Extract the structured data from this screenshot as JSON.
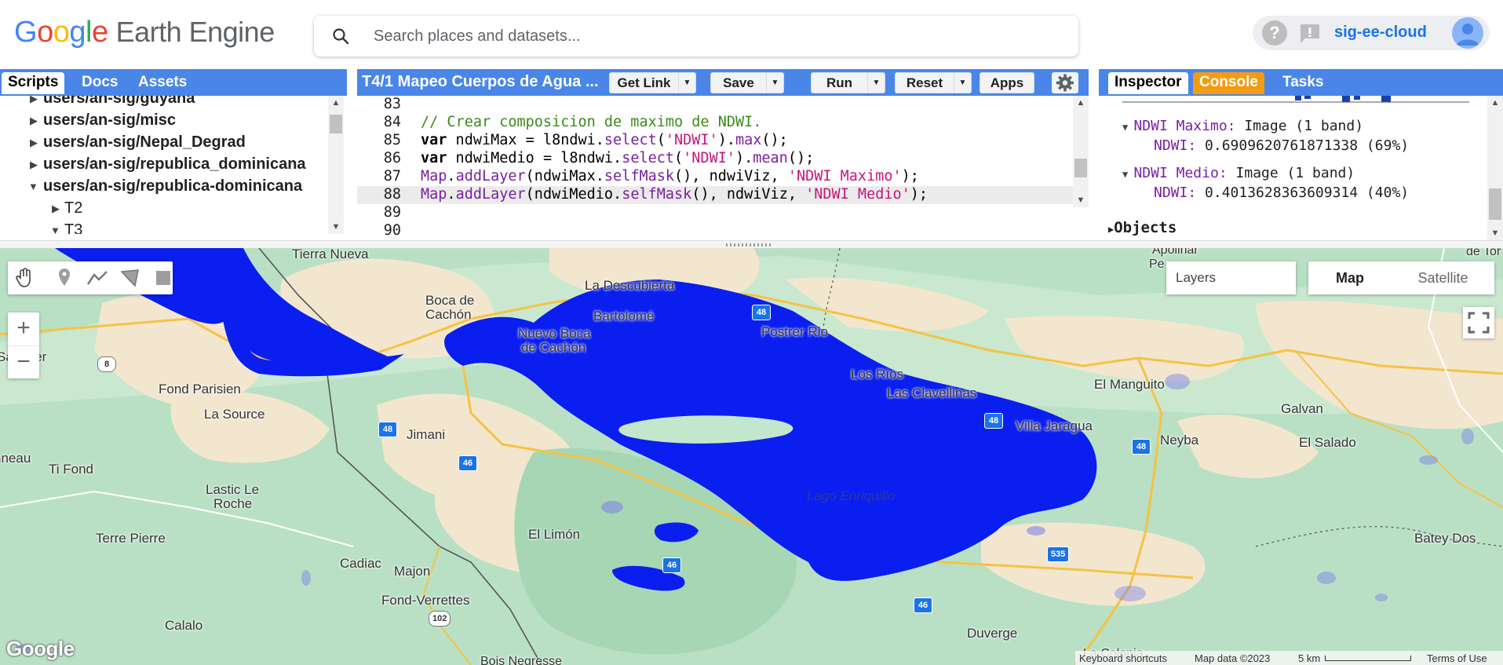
{
  "header": {
    "logo_google": [
      "G",
      "o",
      "o",
      "g",
      "l",
      "e"
    ],
    "logo_product": "Earth Engine",
    "search_placeholder": "Search places and datasets...",
    "project_name": "sig-ee-cloud"
  },
  "scripts_panel": {
    "tabs": [
      "Scripts",
      "Docs",
      "Assets"
    ],
    "tree": [
      {
        "label": "users/an-sig/guyana",
        "type": "user",
        "expanded": false
      },
      {
        "label": "users/an-sig/misc",
        "type": "user",
        "expanded": false
      },
      {
        "label": "users/an-sig/Nepal_Degrad",
        "type": "user",
        "expanded": false
      },
      {
        "label": "users/an-sig/republica_dominicana",
        "type": "user",
        "expanded": false
      },
      {
        "label": "users/an-sig/republica-dominicana",
        "type": "user",
        "expanded": true
      },
      {
        "label": "T2",
        "type": "folder",
        "expanded": false
      },
      {
        "label": "T3",
        "type": "folder",
        "expanded": true
      }
    ]
  },
  "editor": {
    "file_title": "T4/1 Mapeo Cuerpos de Agua ...",
    "buttons": {
      "get_link": "Get Link",
      "save": "Save",
      "run": "Run",
      "reset": "Reset",
      "apps": "Apps"
    },
    "lines": [
      {
        "n": "83",
        "text": ""
      },
      {
        "n": "84",
        "text": "// Crear composicion de maximo de NDWI."
      },
      {
        "n": "85",
        "text": "var ndwiMax = l8ndwi.select('NDWI').max();"
      },
      {
        "n": "86",
        "text": "var ndwiMedio = l8ndwi.select('NDWI').mean();"
      },
      {
        "n": "87",
        "text": "Map.addLayer(ndwiMax.selfMask(), ndwiViz, 'NDWI Maximo');"
      },
      {
        "n": "88",
        "text": "Map.addLayer(ndwiMedio.selfMask(), ndwiViz, 'NDWI Medio');"
      },
      {
        "n": "89",
        "text": ""
      },
      {
        "n": "90",
        "text": ""
      }
    ]
  },
  "inspector": {
    "tabs": [
      "Inspector",
      "Console",
      "Tasks"
    ],
    "entries": [
      {
        "name": "NDWI Maximo:",
        "type": "Image (1 band)",
        "band_key": "NDWI:",
        "band_value": "0.6909620761871338 (69%)"
      },
      {
        "name": "NDWI Medio:",
        "type": "Image (1 band)",
        "band_key": "NDWI:",
        "band_value": "0.4013628363609314 (40%)"
      }
    ],
    "objects_label": "Objects"
  },
  "map": {
    "layers_label": "Layers",
    "map_type": {
      "map": "Map",
      "satellite": "Satellite"
    },
    "places": [
      "Tierra Nueva",
      "La Descubierta",
      "Boca de",
      "Cachón",
      "Bartolomé",
      "Nuevo Boca",
      "de Cachón",
      "Postrer Rio",
      "Santhier",
      "Fond Parisien",
      "La Source",
      "Jimani",
      "Los Ríos",
      "Las Clavellinas",
      "El Manguito",
      "Galvan",
      "Villa Jaragua",
      "Neyba",
      "El Salado",
      "nneau",
      "Ti Fond",
      "Lastic Le",
      "Roche",
      "Terre Pierre",
      "El Limón",
      "Cadiac",
      "Majon",
      "Fond-Verrettes",
      "Calalo",
      "Duverge",
      "Batey Dos",
      "Apolinar",
      "Pe",
      "de Tor",
      "Bois Negresse",
      "La Colonia"
    ],
    "lake_label": "Lago Enriquillo",
    "highways": [
      "8",
      "48",
      "48",
      "46",
      "46",
      "48",
      "48",
      "535",
      "102",
      "46"
    ],
    "attribution": {
      "shortcuts": "Keyboard shortcuts",
      "data": "Map data ©2023",
      "scale": "5 km",
      "terms": "Terms of Use"
    },
    "watermark": "Google",
    "colors": {
      "water_layer": "#0a1ef0",
      "land": "#b9e0c5",
      "urban": "#f3e6cf",
      "road": "#f6c245"
    }
  }
}
